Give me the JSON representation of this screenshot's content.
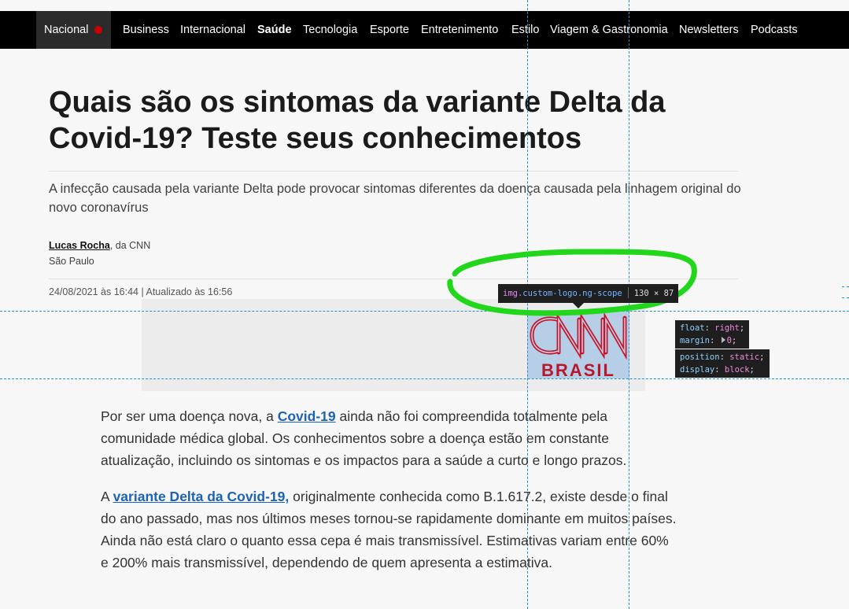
{
  "nav": {
    "active": "Nacional",
    "items": [
      "Business",
      "Internacional",
      "Saúde",
      "Tecnologia",
      "Esporte",
      "Entretenimento",
      "Estilo",
      "Viagem & Gastronomia",
      "Newsletters",
      "Podcasts"
    ]
  },
  "article": {
    "headline": "Quais são os sintomas da variante Delta da Covid-19? Teste seus conhecimentos",
    "subtitle": "A infecção causada pela variante Delta pode provocar sintomas diferentes da doença causada pela linhagem original do novo coronavírus",
    "author": "Lucas Rocha",
    "author_suffix": ", da CNN",
    "location": "São Paulo",
    "dateline": "24/08/2021 às 16:44 | Atualizado às 16:56",
    "p1_before": "Por ser uma doença nova, a ",
    "p1_link": "Covid-19",
    "p1_after": " ainda não foi compreendida totalmente pela comunidade médica global. Os conhecimentos sobre a doença estão em constante atualização, incluindo os sintomas e os impactos para a saúde a curto e longo prazos.",
    "p2_before": "A ",
    "p2_link": "variante Delta da Covid-19,",
    "p2_after": " originalmente conhecida como B.1.617.2, existe desde o final do ano passado, mas nos últimos meses tornou-se rapidamente dominante em muitos países. Ainda não está claro o quanto essa cepa é mais transmissível. Estimativas variam entre 60% e 200% mais transmissível, dependendo de quem apresenta a estimativa."
  },
  "logo": {
    "brand": "CNN",
    "sub": "BRASIL"
  },
  "devtools": {
    "tag": "img",
    "classes": ".custom-logo.ng-scope",
    "size": "130 × 87",
    "float_prop": "float",
    "float_val": "right",
    "margin_prop": "margin",
    "margin_val": "0",
    "position_prop": "position",
    "position_val": "static",
    "display_prop": "display",
    "display_val": "block"
  },
  "colors": {
    "highlight": "#22d61b",
    "guides": "#2a8fc4",
    "link": "#1d63b5",
    "nav_dot": "#cc0000"
  }
}
